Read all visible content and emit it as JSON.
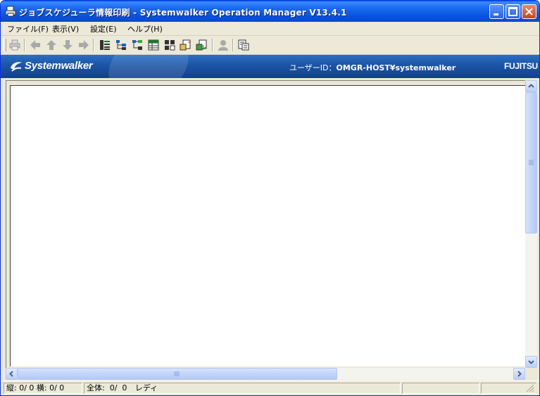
{
  "window": {
    "title": "ジョブスケジューラ情報印刷 - Systemwalker Operation Manager  V13.4.1"
  },
  "menu": {
    "items": [
      {
        "label": "ファイル(F)"
      },
      {
        "label": "表示(V)"
      },
      {
        "label": "設定(E)"
      },
      {
        "label": "ヘルプ(H)"
      }
    ]
  },
  "toolbar": {
    "icons": [
      "print-icon",
      "arrow-left-icon",
      "arrow-up-icon",
      "arrow-down-icon",
      "arrow-right-icon",
      "list-view-icon",
      "tree-view-icon",
      "tree-view-alt-icon",
      "table-view-icon",
      "detail-view-icon",
      "export-icon",
      "import-icon",
      "user-icon",
      "properties-icon"
    ]
  },
  "banner": {
    "brand": "Systemwalker",
    "user_label": "ユーザーID：",
    "user_value": "OMGR-HOST¥systemwalker",
    "company": "FUJITSU"
  },
  "status": {
    "position": "縦: 0/ 0 横: 0/ 0",
    "total": "全体:  0/  0",
    "state": "レディ"
  },
  "colors": {
    "titlebar": "#0a55e0",
    "banner": "#1d57a8",
    "chrome": "#ece9d8"
  }
}
